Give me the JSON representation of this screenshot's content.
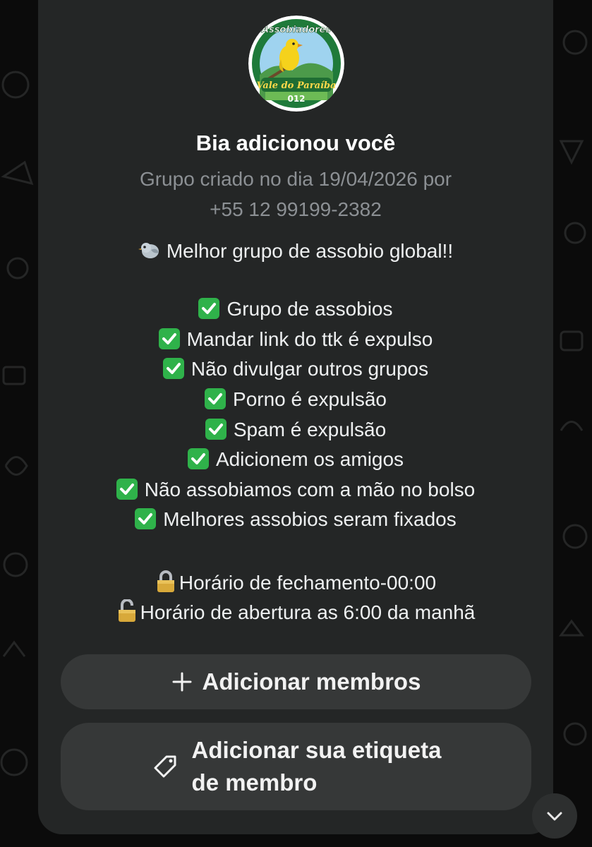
{
  "group_logo": {
    "top_text": "Assobiadores",
    "bottom_text": "Vale do Paraíba",
    "number": "012"
  },
  "title": "Bia adicionou você",
  "created_line1": "Grupo criado no dia 19/04/2026 por",
  "created_line2": "+55 12 99199-2382",
  "description": {
    "headline": "Melhor grupo de assobio global!!",
    "rules": [
      "Grupo de assobios",
      "Mandar link do ttk é expulso",
      "Não divulgar outros grupos",
      "Porno é expulsão",
      "Spam é expulsão",
      "Adicionem os amigos",
      "Não assobiamos com a mão no bolso",
      "Melhores assobios seram fixados"
    ],
    "schedule": [
      "Horário de fechamento-00:00",
      "Horário de abertura as 6:00 da manhã"
    ]
  },
  "buttons": {
    "add_members": "Adicionar membros",
    "member_tag_line1": "Adicionar sua etiqueta",
    "member_tag_line2": "de membro"
  },
  "icons": {
    "bird": "bird-emoji-icon",
    "check": "check-mark-button-icon",
    "lock_closed": "locked-icon",
    "lock_open": "unlocked-icon",
    "plus": "plus-icon",
    "tag": "tag-icon",
    "scroll": "chevron-down-icon"
  },
  "colors": {
    "card": "#242626",
    "button": "#363838",
    "check": "#2fb24a",
    "muted_text": "#8c9094"
  }
}
